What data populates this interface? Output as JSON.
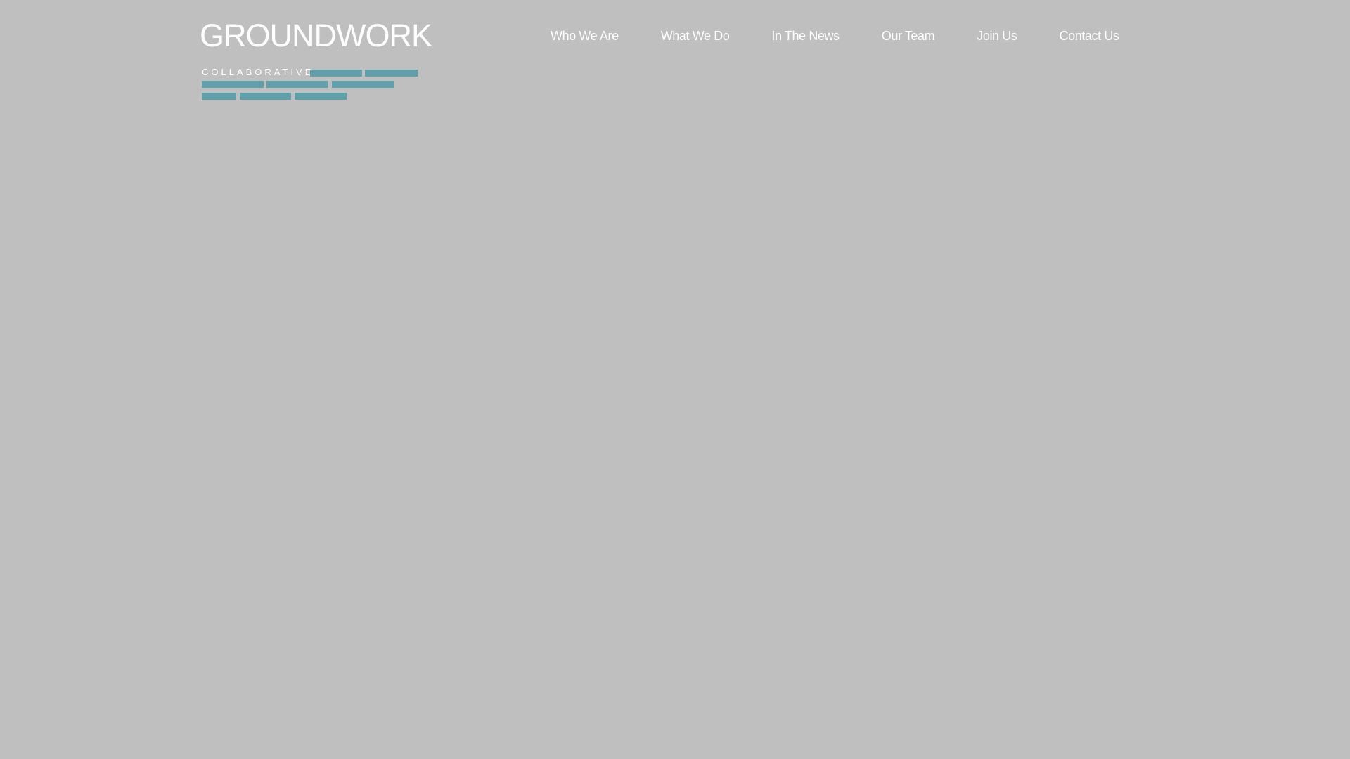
{
  "colors": {
    "background": "#bfbfbf",
    "text": "#ffffff",
    "accent": "#5fa0ab"
  },
  "logo": {
    "name": "GROUNDWORK",
    "subtitle": "COLLABORATIVE"
  },
  "nav": {
    "items": [
      {
        "label": "Who We Are"
      },
      {
        "label": "What We Do"
      },
      {
        "label": "In The News"
      },
      {
        "label": "Our Team"
      },
      {
        "label": "Join Us"
      },
      {
        "label": "Contact Us"
      }
    ]
  }
}
